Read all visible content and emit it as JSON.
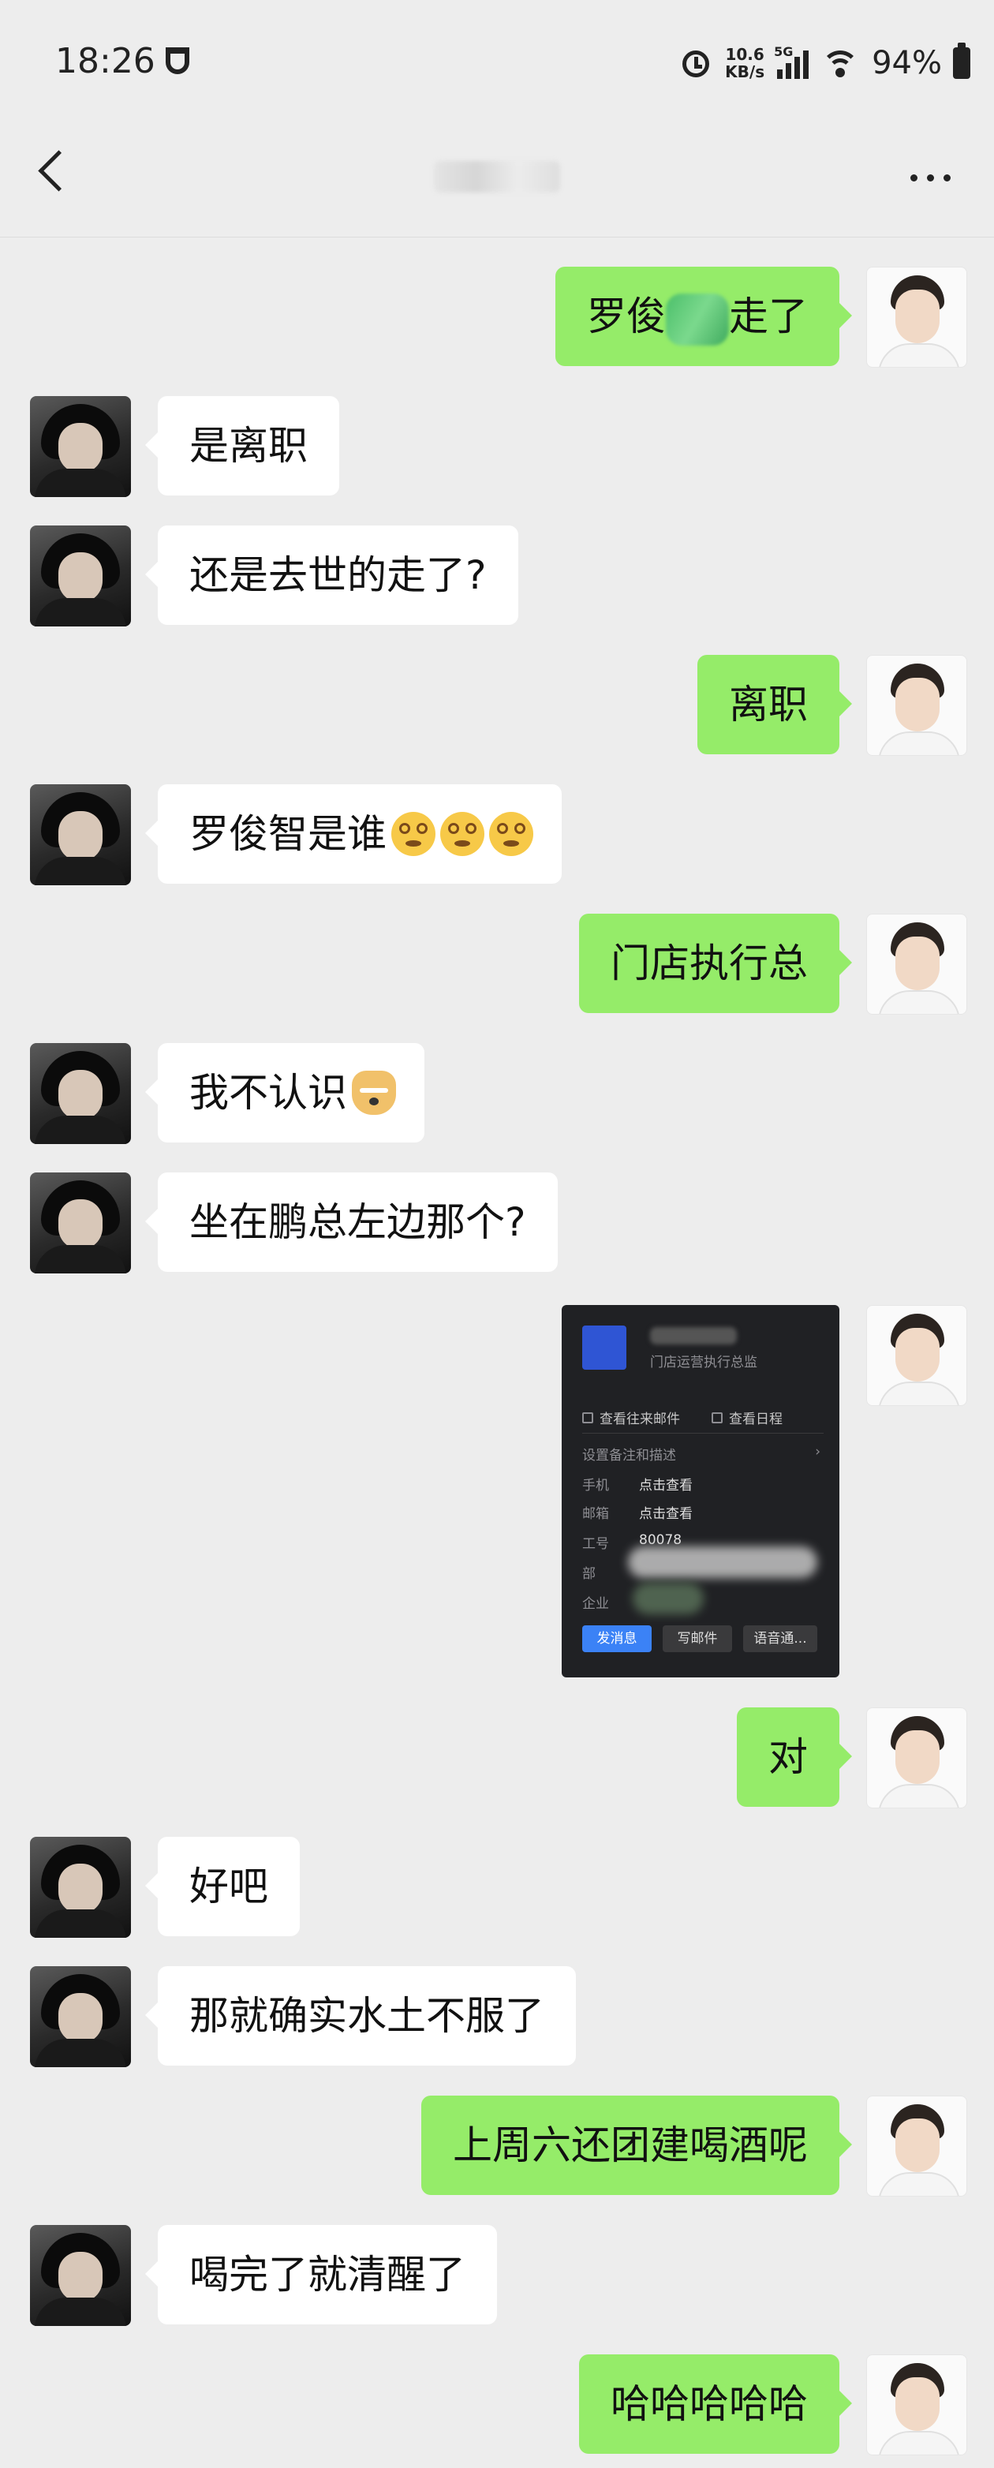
{
  "status_bar": {
    "time": "18:26",
    "net_speed_value": "10.6",
    "net_speed_unit": "KB/s",
    "network_type": "5G",
    "battery_percent": "94%"
  },
  "nav_bar": {
    "back_icon": "chevron-left-icon",
    "more_icon": "more-dots-icon"
  },
  "colors": {
    "background": "#ededed",
    "self_bubble": "#95ec69",
    "other_bubble": "#ffffff"
  },
  "messages": [
    {
      "from": "self",
      "text_before": "罗俊",
      "text_after": "走了"
    },
    {
      "from": "other",
      "text": "是离职"
    },
    {
      "from": "other",
      "text": "还是去世的走了?"
    },
    {
      "from": "self",
      "text": "离职"
    },
    {
      "from": "other",
      "text": "罗俊智是谁",
      "emoji": "dizzy-face-emoji x3"
    },
    {
      "from": "self",
      "text": "门店执行总"
    },
    {
      "from": "other",
      "text": "我不认识",
      "emoji": "doge-emoji"
    },
    {
      "from": "other",
      "text": "坐在鹏总左边那个?"
    },
    {
      "from": "self",
      "type": "image"
    },
    {
      "from": "self",
      "text": "对"
    },
    {
      "from": "other",
      "text": "好吧"
    },
    {
      "from": "other",
      "text": "那就确实水土不服了"
    },
    {
      "from": "self",
      "text": "上周六还团建喝酒呢"
    },
    {
      "from": "other",
      "text": "喝完了就清醒了"
    },
    {
      "from": "self",
      "text": "哈哈哈哈哈"
    }
  ],
  "profile_card": {
    "title": "门店运营执行总监",
    "view_mail": "查看往来邮件",
    "view_schedule": "查看日程",
    "remark": "设置备注和描述",
    "phone_label": "手机",
    "phone_value": "点击查看",
    "email_label": "邮箱",
    "email_value": "点击查看",
    "employee_id_label": "工号",
    "employee_id_value": "80078",
    "department_label": "部",
    "company_label": "企业",
    "send_message": "发消息",
    "write_mail": "写邮件",
    "voice_call": "语音通..."
  }
}
